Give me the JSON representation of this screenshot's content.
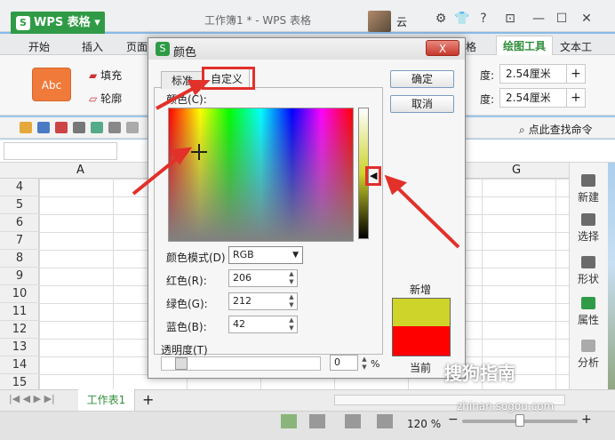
{
  "app": {
    "name": "WPS 表格",
    "doc_title": "工作簿1 * - WPS 表格",
    "user": "云"
  },
  "ribbon_tabs": [
    "开始",
    "插入",
    "页面",
    "格",
    "绘图工具",
    "文本工"
  ],
  "ribbon": {
    "style_preview": "Abc",
    "fill": "填充",
    "outline": "轮廓",
    "height_label": "度:",
    "height_value": "2.54厘米",
    "width_label": "度:",
    "width_value": "2.54厘米",
    "find": "点此查找命令",
    "plus": "+"
  },
  "columns": [
    "A",
    "G"
  ],
  "rows": [
    "4",
    "5",
    "6",
    "7",
    "8",
    "9",
    "10",
    "11",
    "12",
    "13",
    "14",
    "15"
  ],
  "right_panel": [
    "新建",
    "选择",
    "形状",
    "属性",
    "分析"
  ],
  "sheet": {
    "tab": "工作表1",
    "add": "+"
  },
  "status": {
    "zoom": "120 %",
    "minus": "−",
    "plus": "+"
  },
  "dialog": {
    "title": "颜色",
    "close": "X",
    "tabs": [
      "标准",
      "自定义"
    ],
    "color_label": "颜色(C):",
    "mode_label": "颜色模式(D)",
    "mode_value": "RGB",
    "red_label": "红色(R):",
    "red_value": "206",
    "green_label": "绿色(G):",
    "green_value": "212",
    "blue_label": "蓝色(B):",
    "blue_value": "42",
    "transparency_label": "透明度(T)",
    "transparency_value": "0",
    "pct": "%",
    "ok": "确定",
    "cancel": "取消",
    "new_label": "新增",
    "current_label": "当前",
    "new_color": "#CED42A",
    "current_color": "#FF0000"
  },
  "watermark": {
    "text": "搜狗指南",
    "sub": "zhinan.sogou.com"
  }
}
